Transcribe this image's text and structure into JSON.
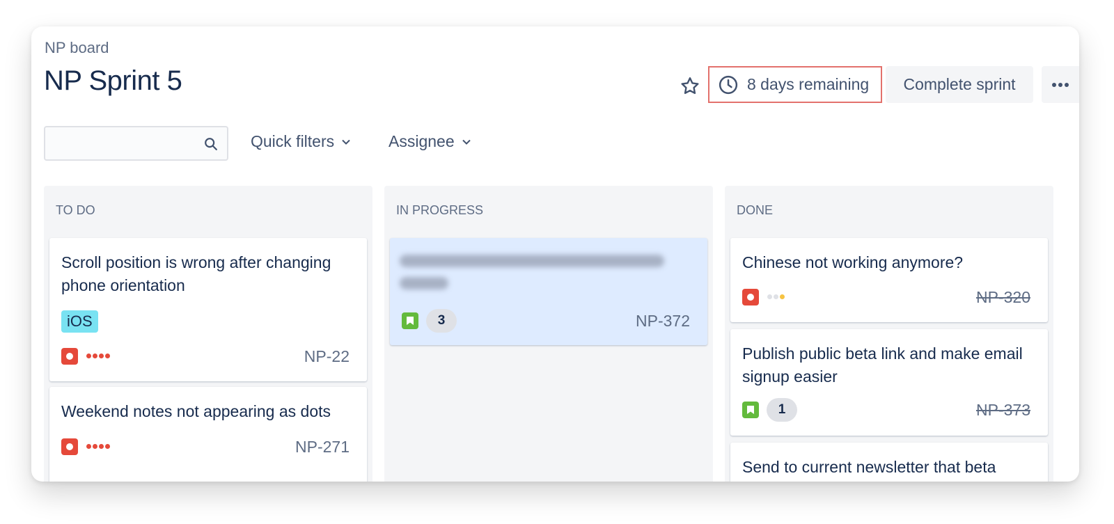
{
  "header": {
    "breadcrumb": "NP board",
    "title": "NP Sprint 5",
    "remaining": "8 days remaining",
    "complete_label": "Complete sprint"
  },
  "filters": {
    "search_placeholder": "",
    "quick_filters": "Quick filters",
    "assignee": "Assignee"
  },
  "columns": [
    {
      "name": "TO DO",
      "cards": [
        {
          "title": "Scroll position is wrong after changing phone orientation",
          "label": "iOS",
          "type": "bug",
          "priority": "highest",
          "key": "NP-22"
        },
        {
          "title": "Weekend notes not appearing as dots",
          "type": "bug",
          "priority": "highest",
          "key": "NP-271"
        }
      ]
    },
    {
      "name": "IN PROGRESS",
      "cards": [
        {
          "title_redacted": true,
          "type": "story",
          "estimate": "3",
          "key": "NP-372"
        }
      ]
    },
    {
      "name": "DONE",
      "cards": [
        {
          "title": "Chinese not working anymore?",
          "type": "bug",
          "priority": "low",
          "key": "NP-320"
        },
        {
          "title": "Publish public beta link and make email signup easier",
          "type": "story",
          "estimate": "1",
          "key": "NP-373"
        },
        {
          "title": "Send to current newsletter that beta"
        }
      ]
    }
  ],
  "colors": {
    "highlight_border": "#e3716c",
    "bug": "#e5493a",
    "story": "#63ba3c",
    "label_ios": "#79e2f2",
    "priority_highest": "#e5493a",
    "priority_low": "#f6c342",
    "in_progress_card": "#deebff"
  }
}
